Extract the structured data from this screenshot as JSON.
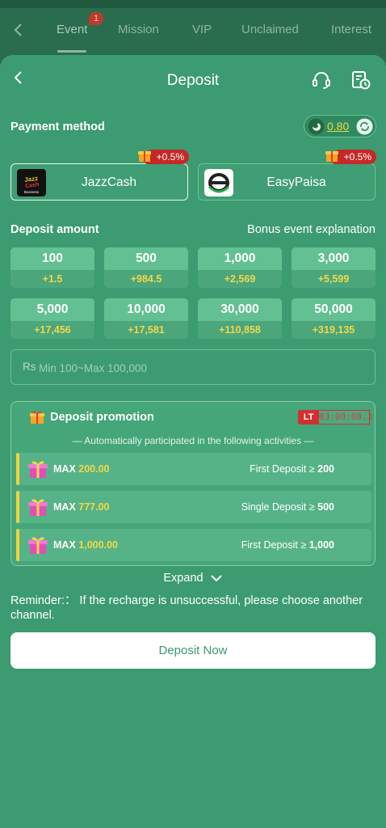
{
  "bg_tabs": {
    "items": [
      "Event",
      "Mission",
      "VIP",
      "Unclaimed",
      "Interest"
    ],
    "active": "Event",
    "event_badge": "1"
  },
  "header": {
    "title": "Deposit"
  },
  "payment": {
    "title": "Payment method",
    "balance": "0.80",
    "methods": [
      {
        "name": "JazzCash",
        "bonus": "+0.5%",
        "selected": true
      },
      {
        "name": "EasyPaisa",
        "bonus": "+0.5%",
        "selected": false
      }
    ]
  },
  "deposit_amount": {
    "title": "Deposit amount",
    "bonus_link": "Bonus event explanation",
    "options": [
      {
        "amount": "100",
        "bonus": "+1.5"
      },
      {
        "amount": "500",
        "bonus": "+984.5"
      },
      {
        "amount": "1,000",
        "bonus": "+2,569"
      },
      {
        "amount": "3,000",
        "bonus": "+5,599"
      },
      {
        "amount": "5,000",
        "bonus": "+17,456"
      },
      {
        "amount": "10,000",
        "bonus": "+17,581"
      },
      {
        "amount": "30,000",
        "bonus": "+110,858"
      },
      {
        "amount": "50,000",
        "bonus": "+319,135"
      }
    ],
    "currency": "Rs",
    "placeholder": "Min 100~Max 100,000"
  },
  "promotion": {
    "title": "Deposit promotion",
    "timer_label": "LT",
    "timer": "03:00:08.3",
    "subtitle": "— Automatically participated in the following activities —",
    "items": [
      {
        "max_label": "MAX",
        "max_value": "200.00",
        "condition": "First Deposit ≥",
        "threshold": "200"
      },
      {
        "max_label": "MAX",
        "max_value": "777.00",
        "condition": "Single Deposit ≥",
        "threshold": "500"
      },
      {
        "max_label": "MAX",
        "max_value": "1,000.00",
        "condition": "First Deposit ≥",
        "threshold": "1,000"
      }
    ],
    "expand_label": "Expand"
  },
  "reminder": "Reminder:： If the recharge is unsuccessful, please choose another channel.",
  "cta": "Deposit Now",
  "colors": {
    "background": "#3c9b70",
    "accent_yellow": "#f2d84a",
    "badge_red": "#c62828"
  }
}
